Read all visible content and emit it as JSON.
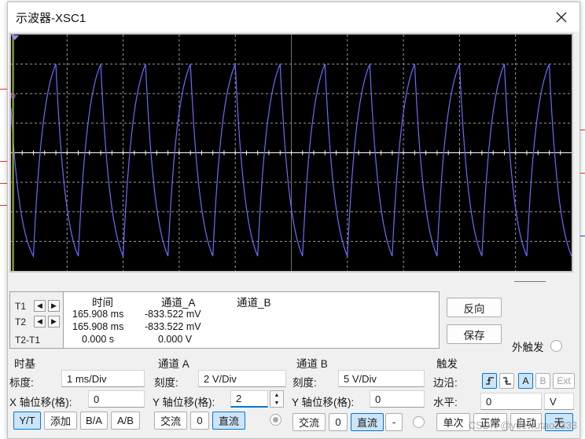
{
  "window": {
    "title": "示波器-XSC1",
    "close_label": "✕"
  },
  "cursor_readout": {
    "labels": {
      "t1": "T1",
      "t2": "T2",
      "t2_t1": "T2-T1"
    },
    "headers": {
      "time": "时间",
      "channel_a": "通道_A",
      "channel_b": "通道_B"
    },
    "rows": [
      {
        "time": "165.908 ms",
        "channel_a": "-833.522 mV",
        "channel_b": ""
      },
      {
        "time": "165.908 ms",
        "channel_a": "-833.522 mV",
        "channel_b": ""
      },
      {
        "time": "0.000 s",
        "channel_a": "0.000 V",
        "channel_b": ""
      }
    ]
  },
  "buttons": {
    "reverse": "反向",
    "save": "保存",
    "external_trigger": "外触发"
  },
  "timebase": {
    "title": "时基",
    "scale_label": "标度:",
    "scale_value": "1 ms/Div",
    "x_offset_label": "X 轴位移(格):",
    "x_offset_value": "0",
    "modes": [
      "Y/T",
      "添加",
      "B/A",
      "A/B"
    ],
    "active_mode": "Y/T"
  },
  "channel_a": {
    "title": "通道 A",
    "scale_label": "刻度:",
    "scale_value": "2  V/Div",
    "y_offset_label": "Y 轴位移(格):",
    "y_offset_value": "2",
    "coupling": [
      "交流",
      "0",
      "直流"
    ],
    "active_coupling": "直流"
  },
  "channel_b": {
    "title": "通道 B",
    "scale_label": "刻度:",
    "scale_value": "5  V/Div",
    "y_offset_label": "Y 轴位移(格):",
    "y_offset_value": "0",
    "coupling": [
      "交流",
      "0",
      "直流",
      "-"
    ],
    "active_coupling": "直流"
  },
  "trigger": {
    "title": "触发",
    "edge_label": "边沿:",
    "edge_buttons": [
      "rising-edge",
      "falling-edge",
      "A",
      "B",
      "Ext"
    ],
    "level_label": "水平:",
    "level_value": "0",
    "level_unit": "V",
    "modes": [
      "单次",
      "正常",
      "自动",
      "无"
    ],
    "active_mode": "无"
  },
  "watermark": "CSDN @yuewutao2333",
  "colors": {
    "trace": "#6b6bff",
    "grid": "#9a9a9a",
    "center_axis": "#ffffff",
    "cursor_t1": "#ff3b3b",
    "cursor_t2": "#3bff3b",
    "active_accent": "#0078d7"
  },
  "chart_data": {
    "type": "line",
    "title": "",
    "xlabel": "",
    "ylabel": "",
    "divisions": {
      "x": 10,
      "y": 8
    },
    "series": [
      {
        "x": [
          0.0,
          0.4,
          0.8,
          1.2,
          1.6,
          2.0,
          2.4,
          2.8,
          3.2,
          3.6,
          4.0,
          4.4,
          4.8,
          5.2,
          5.6,
          6.0,
          6.4,
          6.8,
          7.2,
          7.6,
          8.0,
          8.4,
          8.8,
          9.2,
          9.6,
          10.0
        ],
        "y": [
          1.5,
          -3.5,
          3.0,
          -3.5,
          3.0,
          -3.5,
          3.0,
          -3.5,
          3.0,
          -3.5,
          3.0,
          -3.5,
          3.0,
          -3.5,
          3.0,
          -3.5,
          3.0,
          -3.5,
          3.0,
          -3.5,
          3.0,
          -3.5,
          3.0,
          -3.5,
          3.0,
          -3.5
        ]
      }
    ]
  }
}
